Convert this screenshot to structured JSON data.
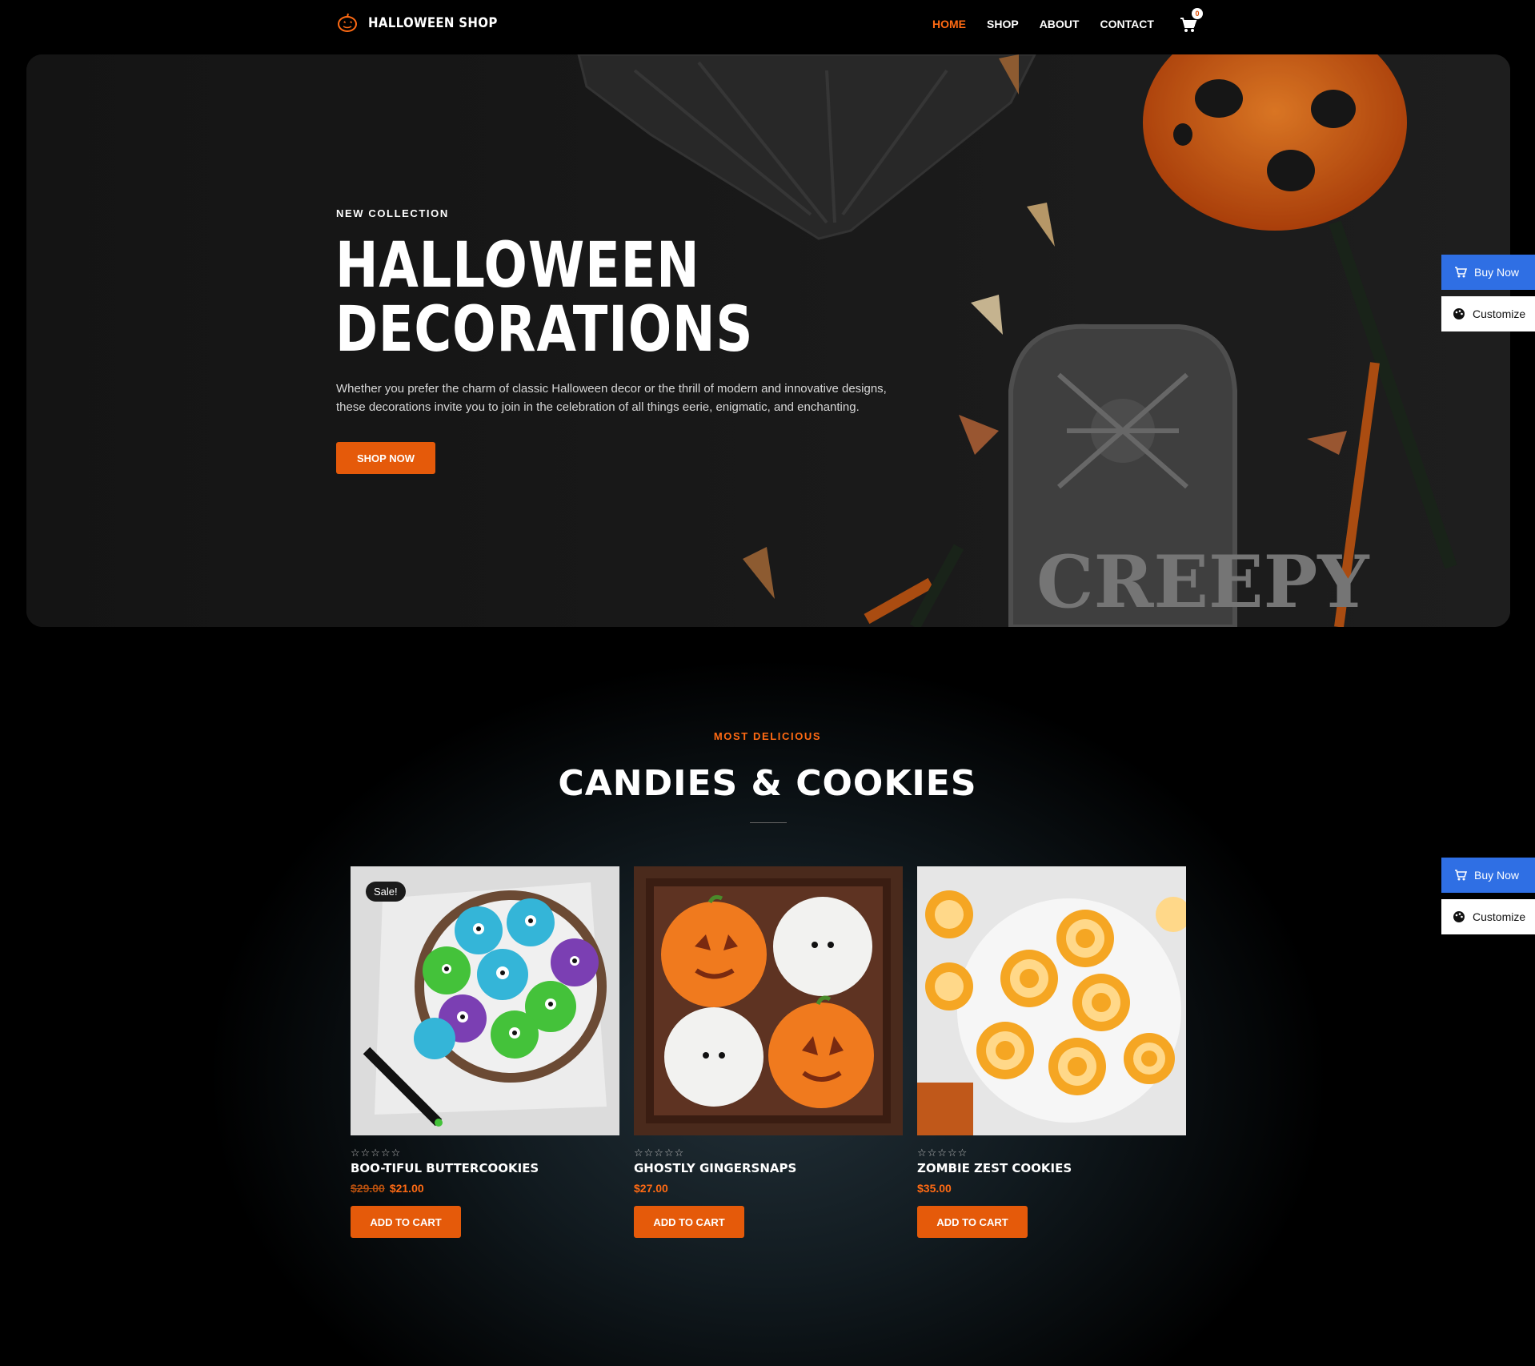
{
  "header": {
    "logo_text": "HALLOWEEN SHOP",
    "nav": [
      {
        "label": "HOME"
      },
      {
        "label": "SHOP"
      },
      {
        "label": "ABOUT"
      },
      {
        "label": "CONTACT"
      }
    ],
    "cart_count": "0"
  },
  "hero": {
    "eyebrow": "NEW COLLECTION",
    "title_line1": "HALLOWEEN",
    "title_line2": "DECORATIONS",
    "description": "Whether you prefer the charm of classic Halloween decor or the thrill of modern and innovative designs, these decorations invite you to join in the celebration of all things eerie, enigmatic, and enchanting.",
    "cta": "SHOP NOW",
    "tombstone_text": "CREEPY"
  },
  "side_tools": {
    "buy_label": "Buy Now",
    "customize_label": "Customize"
  },
  "products_section": {
    "eyebrow": "MOST DELICIOUS",
    "title": "CANDIES & COOKIES",
    "products": [
      {
        "name": "BOO-TIFUL BUTTERCOOKIES",
        "old_price": "$29.00",
        "price": "$21.00",
        "badge": "Sale!",
        "button": "ADD TO CART"
      },
      {
        "name": "GHOSTLY GINGERSNAPS",
        "price": "$27.00",
        "button": "ADD TO CART"
      },
      {
        "name": "ZOMBIE ZEST COOKIES",
        "price": "$35.00",
        "button": "ADD TO CART"
      }
    ]
  },
  "colors": {
    "accent": "#e55a0a",
    "accent_text": "#ff6a13",
    "buy_blue": "#2f6fe4"
  }
}
